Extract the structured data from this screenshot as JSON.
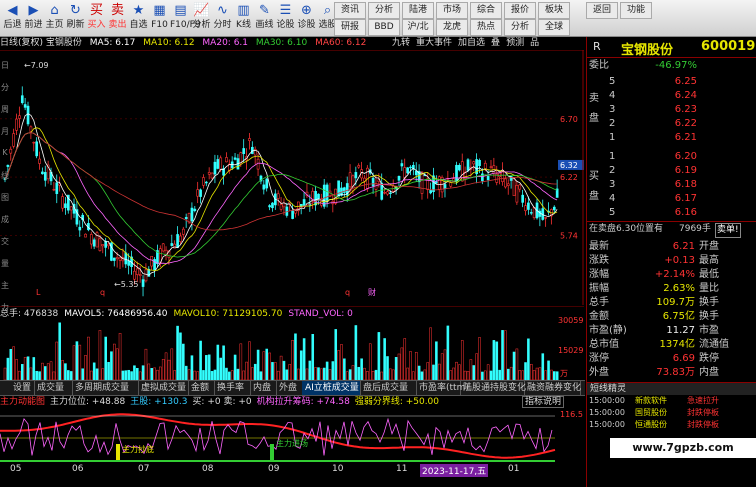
{
  "toolbar": {
    "buttons": [
      {
        "label": "后退",
        "icon": "◀"
      },
      {
        "label": "前进",
        "icon": "▶"
      },
      {
        "label": "主页",
        "icon": "⌂"
      },
      {
        "label": "刷新",
        "icon": "↻"
      },
      {
        "label": "买入",
        "icon": "买",
        "red": true
      },
      {
        "label": "卖出",
        "icon": "卖",
        "red": true
      },
      {
        "label": "自选",
        "icon": "★"
      },
      {
        "label": "F10",
        "icon": "▦"
      },
      {
        "label": "F10/F9",
        "icon": "▤"
      },
      {
        "label": "分析",
        "icon": "📈"
      },
      {
        "label": "分时",
        "icon": "∿"
      },
      {
        "label": "K线",
        "icon": "▥"
      },
      {
        "label": "画线",
        "icon": "✎"
      },
      {
        "label": "论股",
        "icon": "☰"
      },
      {
        "label": "诊股",
        "icon": "⊕"
      },
      {
        "label": "选股",
        "icon": "⌕"
      }
    ],
    "right_top": [
      "资讯",
      "分析",
      "陆港",
      "市场",
      "综合",
      "报价",
      "板块"
    ],
    "right_bottom": [
      "研报",
      "BBD",
      "沪/北",
      "龙虎",
      "热点",
      "分析",
      "全球"
    ],
    "far_right": [
      "返回",
      "功能"
    ]
  },
  "chart_header": {
    "stock": "日线(复权) 宝钢股份",
    "ma5": "MA5: 6.17",
    "ma10": "MA10: 6.12",
    "ma20": "MA20: 6.1",
    "ma30": "MA30: 6.10",
    "ma60": "MA60: 6.12",
    "links": [
      "九转",
      "重大事件",
      "加自选",
      "叠",
      "预测",
      "品"
    ]
  },
  "main_chart": {
    "price_labels": [
      "6.70",
      "6.22",
      "5.74"
    ],
    "last_price": "6.32",
    "high_label": "7.09",
    "low_label": "5.35",
    "markers": [
      "L",
      "q",
      "q",
      "财"
    ]
  },
  "volume": {
    "header": [
      "总手: 476838",
      "MAVOL5: 76486956.40",
      "MAVOL10: 71129105.70",
      "STAND_VOL: 0"
    ],
    "axis": [
      "30059",
      "15029",
      "万"
    ]
  },
  "tabs": [
    "设置",
    "成交量",
    "多周期成交量",
    "虚拟成交量",
    "金额",
    "换手率",
    "内盘",
    "外盘",
    "AI立桩成交量",
    "盘后成交量",
    "市盈率(ttm)",
    "陆股通持股变化",
    "融资融券变化"
  ],
  "indicator": {
    "header": [
      "主力动能图",
      "主力位位: +48.88",
      "王股: +130.3",
      "买: +0 卖: +0",
      "机构拉升筹码: +74.58",
      "强弱分界线: +50.00"
    ],
    "help": "指标说明",
    "axis_top": "116.5",
    "labels": [
      "主力抄底",
      "主力进场"
    ]
  },
  "dates": [
    "05",
    "06",
    "07",
    "08",
    "09",
    "10",
    "11",
    "12",
    "01"
  ],
  "date_highlight": "2023-11-17,五",
  "right_panel": {
    "code_prefix": "R",
    "name": "宝钢股份",
    "code": "600019",
    "weibi_label": "委比",
    "weibi": "-46.97%",
    "sell_side": "卖盘",
    "sells": [
      {
        "n": "5",
        "p": "6.25"
      },
      {
        "n": "4",
        "p": "6.24"
      },
      {
        "n": "3",
        "p": "6.23"
      },
      {
        "n": "2",
        "p": "6.22"
      },
      {
        "n": "1",
        "p": "6.21"
      }
    ],
    "buy_side": "买盘",
    "buys": [
      {
        "n": "1",
        "p": "6.20"
      },
      {
        "n": "2",
        "p": "6.19"
      },
      {
        "n": "3",
        "p": "6.18"
      },
      {
        "n": "4",
        "p": "6.17"
      },
      {
        "n": "5",
        "p": "6.16"
      }
    ],
    "order_line": "在卖盘6.30位置有",
    "order_qty": "7969手",
    "order_tag": "卖单!",
    "stats": [
      {
        "l": "最新",
        "v": "6.21",
        "l2": "开盘"
      },
      {
        "l": "涨跌",
        "v": "+0.13",
        "l2": "最高"
      },
      {
        "l": "涨幅",
        "v": "+2.14%",
        "l2": "最低"
      },
      {
        "l": "振幅",
        "v": "2.63%",
        "l2": "量比"
      },
      {
        "l": "总手",
        "v": "109.7万",
        "l2": "换手"
      },
      {
        "l": "金额",
        "v": "6.75亿",
        "l2": "换手"
      },
      {
        "l": "市盈(静)",
        "v": "11.27",
        "l2": "市盈"
      },
      {
        "l": "总市值",
        "v": "1374亿",
        "l2": "流通值"
      },
      {
        "l": "涨停",
        "v": "6.69",
        "l2": "跌停"
      },
      {
        "l": "外盘",
        "v": "73.83万",
        "l2": "内盘"
      }
    ],
    "news_title": "短线精灵",
    "news": [
      {
        "t": "15:00:00",
        "s": "新款软件",
        "m": "急速拉升"
      },
      {
        "t": "15:00:00",
        "s": "国贸股份",
        "m": "封跌停板"
      },
      {
        "t": "15:00:00",
        "s": "恒通股份",
        "m": "封跌停板"
      }
    ]
  },
  "side_left": [
    "日",
    "分",
    "周",
    "月",
    "K",
    "线",
    "图",
    "成",
    "交",
    "量",
    "主",
    "力"
  ],
  "watermark": "www.7gpzb.com"
}
